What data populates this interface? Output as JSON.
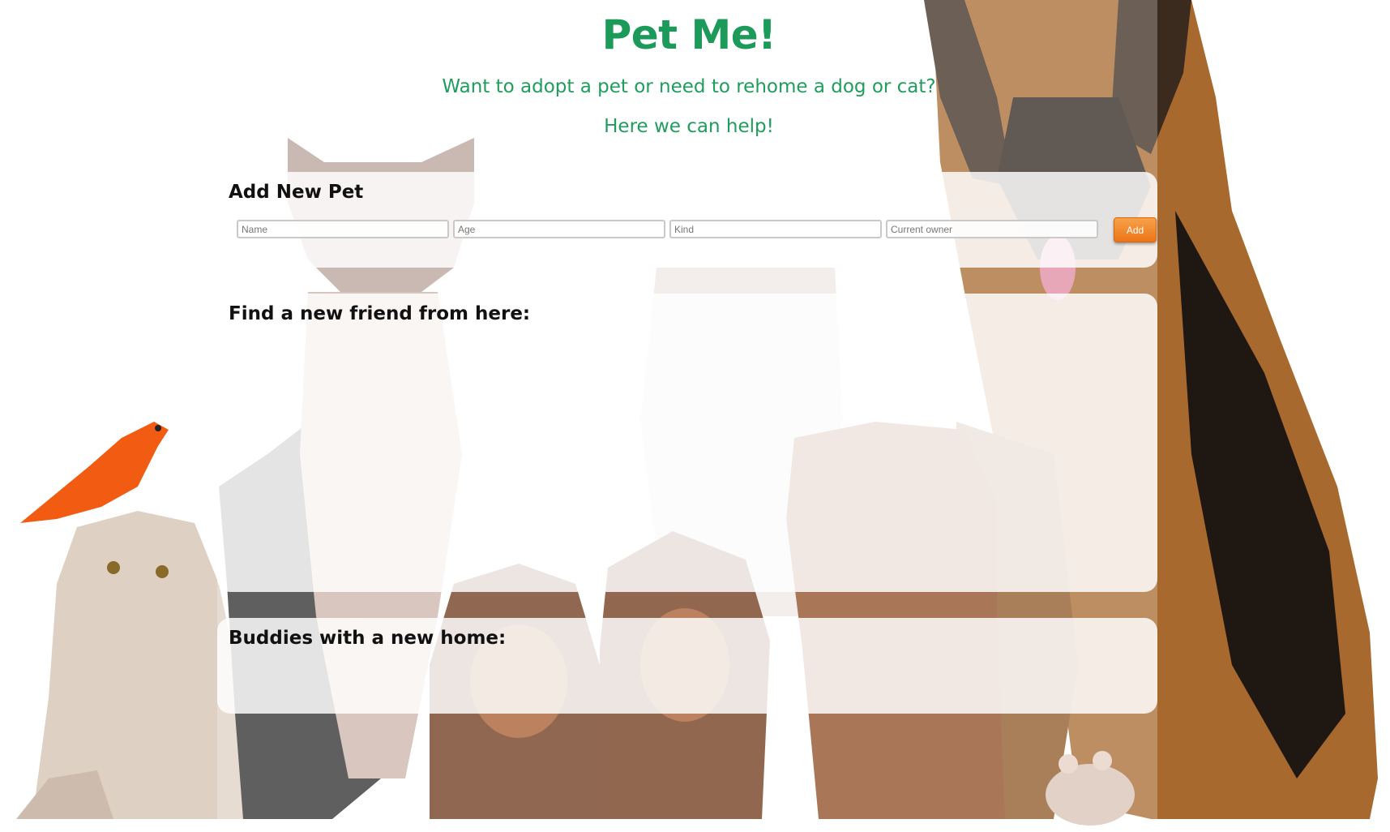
{
  "header": {
    "title": "Pet Me!",
    "tagline_1": "Want to adopt a pet or need to rehome a dog or cat?",
    "tagline_2": "Here we can help!"
  },
  "add_pet": {
    "heading": "Add New Pet",
    "name_placeholder": "Name",
    "age_placeholder": "Age",
    "kind_placeholder": "Kind",
    "owner_placeholder": "Current owner",
    "name_value": "",
    "age_value": "",
    "kind_value": "",
    "owner_value": "",
    "add_label": "Add"
  },
  "find_friend": {
    "heading": "Find a new friend from here:"
  },
  "adopted": {
    "heading": "Buddies with a new home:"
  },
  "colors": {
    "title_green": "#1b9a5a",
    "button_orange": "#ec7417"
  }
}
